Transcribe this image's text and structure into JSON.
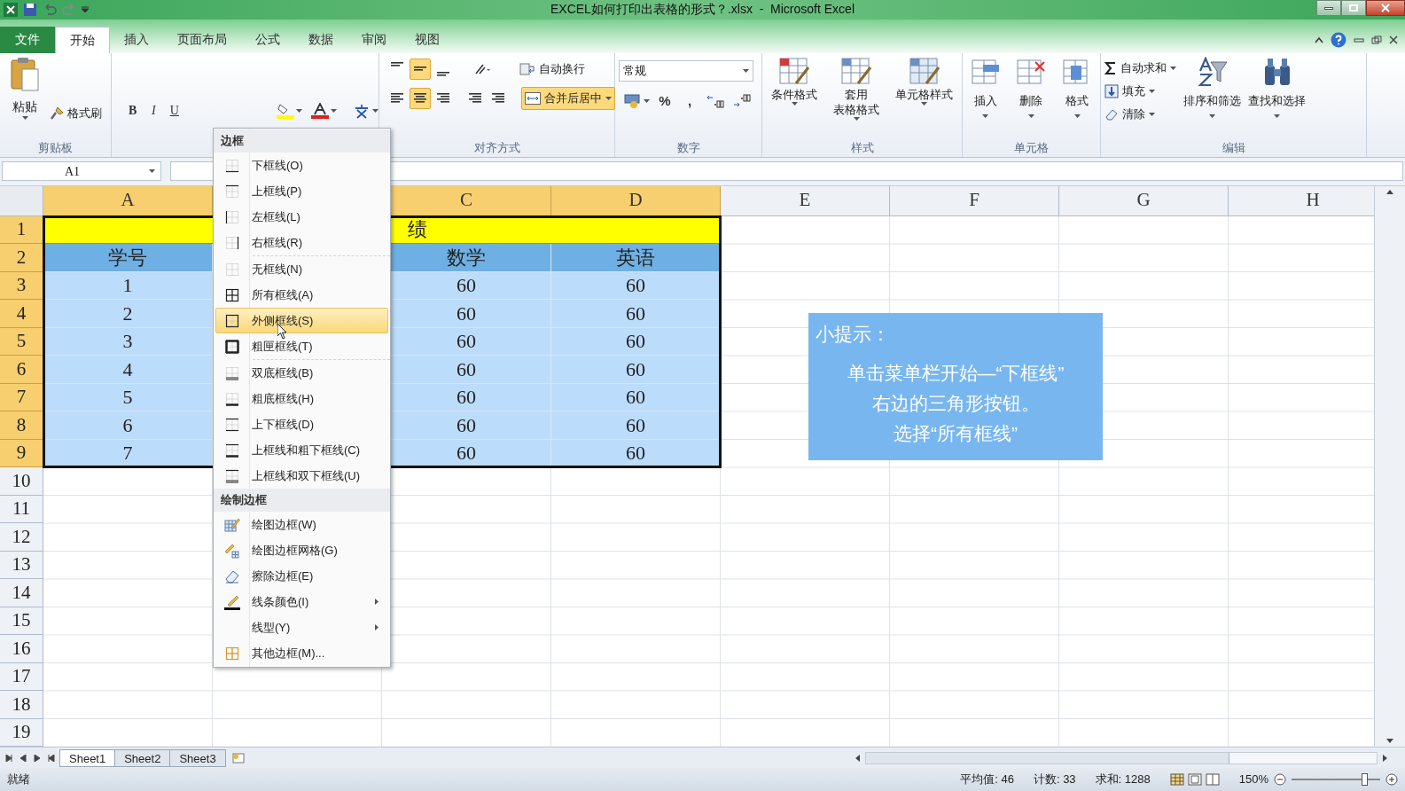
{
  "title_bar": {
    "title": "EXCEL如何打印出表格的形式？.xlsx  -  Microsoft Excel"
  },
  "ribbon_tabs": [
    {
      "label": "文件",
      "kind": "file",
      "selected": false
    },
    {
      "label": "开始",
      "kind": "tab",
      "selected": true
    },
    {
      "label": "插入",
      "kind": "tab",
      "selected": false
    },
    {
      "label": "页面布局",
      "kind": "tab",
      "selected": false
    },
    {
      "label": "公式",
      "kind": "tab",
      "selected": false
    },
    {
      "label": "数据",
      "kind": "tab",
      "selected": false
    },
    {
      "label": "审阅",
      "kind": "tab",
      "selected": false
    },
    {
      "label": "视图",
      "kind": "tab",
      "selected": false
    }
  ],
  "ribbon": {
    "clipboard": {
      "paste": "粘贴",
      "format_painter": "格式刷",
      "label": "剪贴板"
    },
    "font": {
      "buttons": [
        "B",
        "I",
        "U"
      ]
    },
    "alignment": {
      "top_buttons": [
        {
          "selected": false
        },
        {
          "selected": true
        },
        {
          "selected": false
        }
      ],
      "bottom_buttons": [
        {
          "selected": false
        },
        {
          "selected": true
        },
        {
          "selected": false
        }
      ],
      "wrap_text": "自动换行",
      "merge": {
        "label": "合并后居中",
        "selected": true
      },
      "label": "对齐方式"
    },
    "number": {
      "format": "常规",
      "symbols": [
        "%",
        ","
      ],
      "label": "数字"
    },
    "styles": {
      "buttons": [
        {
          "lines": [
            "条件格式"
          ]
        },
        {
          "lines": [
            "套用",
            "表格格式"
          ]
        },
        {
          "lines": [
            "单元格样式"
          ]
        }
      ],
      "label": "样式"
    },
    "cells": {
      "buttons": [
        "插入",
        "删除",
        "格式"
      ],
      "label": "单元格"
    },
    "editing": {
      "small": [
        "自动求和",
        "填充",
        "清除"
      ],
      "big": [
        "排序和筛选",
        "查找和选择"
      ],
      "label": "编辑"
    }
  },
  "formula_bar": {
    "name_box": "A1"
  },
  "columns": [
    {
      "label": "A",
      "selected": true
    },
    {
      "label": "C",
      "selected": true
    },
    {
      "label": "D",
      "selected": true
    },
    {
      "label": "E",
      "selected": false
    },
    {
      "label": "F",
      "selected": false
    },
    {
      "label": "G",
      "selected": false
    },
    {
      "label": "H",
      "selected": false
    }
  ],
  "rows": [
    {
      "number": "1",
      "selected": true,
      "kind": "title",
      "title": "绩"
    },
    {
      "number": "2",
      "selected": true,
      "kind": "header",
      "cells": [
        "学号",
        "数学",
        "英语"
      ]
    },
    {
      "number": "3",
      "selected": true,
      "kind": "data",
      "cells": [
        "1",
        "60",
        "60"
      ]
    },
    {
      "number": "4",
      "selected": true,
      "kind": "data",
      "cells": [
        "2",
        "60",
        "60"
      ]
    },
    {
      "number": "5",
      "selected": true,
      "kind": "data",
      "cells": [
        "3",
        "60",
        "60"
      ]
    },
    {
      "number": "6",
      "selected": true,
      "kind": "data",
      "cells": [
        "4",
        "60",
        "60"
      ]
    },
    {
      "number": "7",
      "selected": true,
      "kind": "data",
      "cells": [
        "5",
        "60",
        "60"
      ]
    },
    {
      "number": "8",
      "selected": true,
      "kind": "data",
      "cells": [
        "6",
        "60",
        "60"
      ]
    },
    {
      "number": "9",
      "selected": true,
      "kind": "data",
      "cells": [
        "7",
        "60",
        "60"
      ]
    },
    {
      "number": "10",
      "selected": false
    },
    {
      "number": "11",
      "selected": false
    },
    {
      "number": "12",
      "selected": false
    },
    {
      "number": "13",
      "selected": false
    },
    {
      "number": "14",
      "selected": false
    },
    {
      "number": "15",
      "selected": false
    },
    {
      "number": "16",
      "selected": false
    },
    {
      "number": "17",
      "selected": false
    },
    {
      "number": "18",
      "selected": false
    },
    {
      "number": "19",
      "selected": false
    }
  ],
  "tip": {
    "title": "小提示：",
    "lines": [
      "单击菜单栏开始—“下框线”",
      "右边的三角形按钮。",
      "选择“所有框线”"
    ]
  },
  "border_menu": {
    "sections": [
      {
        "title": "边框",
        "groups": [
          [
            {
              "label": "下框线(O)",
              "selected": false
            },
            {
              "label": "上框线(P)",
              "selected": false
            },
            {
              "label": "左框线(L)",
              "selected": false
            },
            {
              "label": "右框线(R)",
              "selected": false
            }
          ],
          [
            {
              "label": "无框线(N)",
              "selected": false
            },
            {
              "label": "所有框线(A)",
              "selected": false
            },
            {
              "label": "外侧框线(S)",
              "selected": true
            },
            {
              "label": "粗匣框线(T)",
              "selected": false
            }
          ],
          [
            {
              "label": "双底框线(B)",
              "selected": false
            },
            {
              "label": "粗底框线(H)",
              "selected": false
            },
            {
              "label": "上下框线(D)",
              "selected": false
            },
            {
              "label": "上框线和粗下框线(C)",
              "selected": false
            },
            {
              "label": "上框线和双下框线(U)",
              "selected": false
            }
          ]
        ]
      },
      {
        "title": "绘制边框",
        "groups": [
          [
            {
              "label": "绘图边框(W)",
              "selected": false
            },
            {
              "label": "绘图边框网格(G)",
              "selected": false
            },
            {
              "label": "擦除边框(E)",
              "selected": false
            },
            {
              "label": "线条颜色(I)",
              "selected": false,
              "submenu": true
            },
            {
              "label": "线型(Y)",
              "selected": false,
              "submenu": true
            },
            {
              "label": "其他边框(M)...",
              "selected": false
            }
          ]
        ]
      }
    ]
  },
  "sheet_tabs": [
    {
      "label": "Sheet1",
      "selected": true
    },
    {
      "label": "Sheet2",
      "selected": false
    },
    {
      "label": "Sheet3",
      "selected": false
    }
  ],
  "status_bar": {
    "ready": "就绪",
    "average": "平均值: 46",
    "count": "计数: 33",
    "sum": "求和: 1288",
    "zoom": "150%",
    "zoom_slider": {
      "level": 0.82
    }
  }
}
